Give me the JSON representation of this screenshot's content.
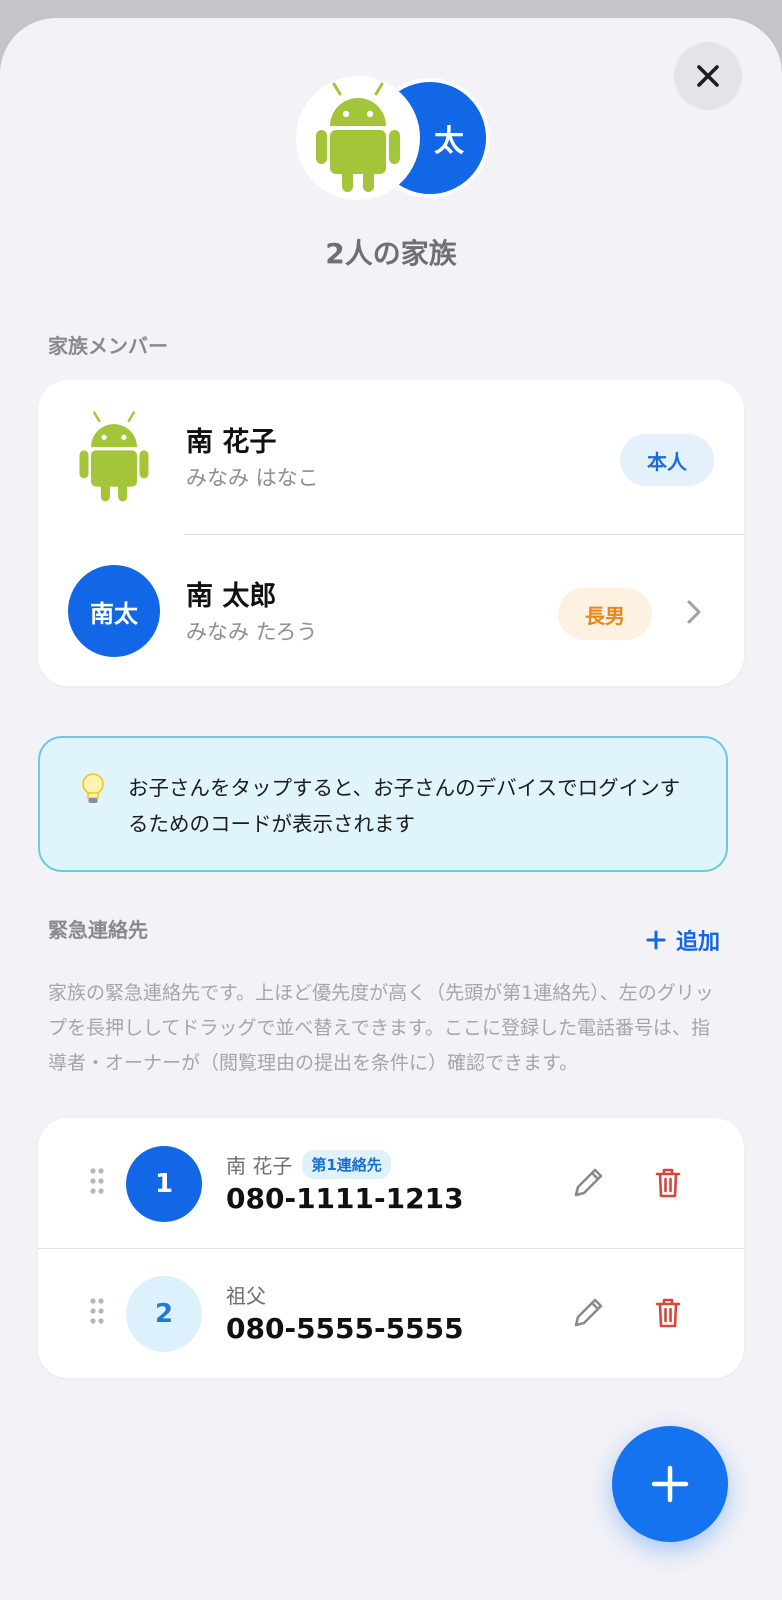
{
  "header": {
    "hero_initial": "太",
    "title": "2人の家族",
    "close_icon": "close-icon"
  },
  "members_section": {
    "label": "家族メンバー",
    "members": [
      {
        "name": "南 花子",
        "kana": "みなみ はなこ",
        "avatar": "android-icon",
        "role": "本人",
        "role_color": "#1a6fd4"
      },
      {
        "name": "南 太郎",
        "kana": "みなみ たろう",
        "avatar_text": "南太",
        "role": "長男",
        "role_color": "#e4891c",
        "chevron_icon": "chevron-right-icon"
      }
    ]
  },
  "info": {
    "icon": "lightbulb-icon",
    "text": "お子さんをタップすると、お子さんのデバイスでログインするためのコードが表示されます"
  },
  "emergency_section": {
    "label": "緊急連絡先",
    "add_label": "追加",
    "description": "家族の緊急連絡先です。上ほど優先度が高く（先頭が第1連絡先）、左のグリップを長押ししてドラッグで並べ替えできます。ここに登録した電話番号は、指導者・オーナーが（閲覧理由の提出を条件に）確認できます。",
    "contacts": [
      {
        "order": "1",
        "name": "南 花子",
        "badge": "第1連絡先",
        "phone": "080-1111-1213"
      },
      {
        "order": "2",
        "name": "祖父",
        "phone": "080-5555-5555"
      }
    ]
  },
  "colors": {
    "accent": "#1267e6",
    "danger": "#d9453a",
    "background": "#f2f2f7"
  }
}
